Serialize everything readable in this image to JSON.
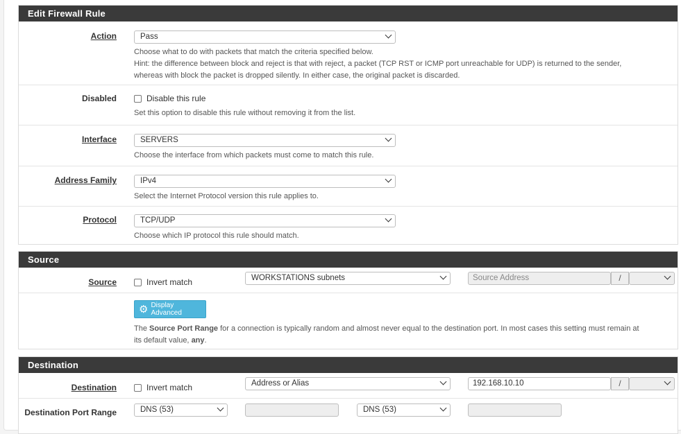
{
  "edit_rule": {
    "title": "Edit Firewall Rule",
    "action": {
      "label": "Action",
      "value": "Pass",
      "help1": "Choose what to do with packets that match the criteria specified below.",
      "help2": "Hint: the difference between block and reject is that with reject, a packet (TCP RST or ICMP port unreachable for UDP) is returned to the sender,",
      "help3": "whereas with block the packet is dropped silently. In either case, the original packet is discarded."
    },
    "disabled": {
      "label": "Disabled",
      "checkbox_label": "Disable this rule",
      "help": "Set this option to disable this rule without removing it from the list."
    },
    "interface": {
      "label": "Interface",
      "value": "SERVERS",
      "help": "Choose the interface from which packets must come to match this rule."
    },
    "address_family": {
      "label": "Address Family",
      "value": "IPv4",
      "help": "Select the Internet Protocol version this rule applies to."
    },
    "protocol": {
      "label": "Protocol",
      "value": "TCP/UDP",
      "help": "Choose which IP protocol this rule should match."
    }
  },
  "source": {
    "title": "Source",
    "label": "Source",
    "invert_label": "Invert match",
    "type_value": "WORKSTATIONS subnets",
    "address_placeholder": "Source Address",
    "slash": "/",
    "advanced_button": "Display Advanced",
    "help_pre": "The ",
    "help_bold": "Source Port Range",
    "help_mid": " for a connection is typically random and almost never equal to the destination port. In most cases this setting must remain at",
    "help_line2_pre": "its default value, ",
    "help_line2_bold": "any",
    "help_line2_end": "."
  },
  "destination": {
    "title": "Destination",
    "label": "Destination",
    "invert_label": "Invert match",
    "type_value": "Address or Alias",
    "address_value": "192.168.10.10",
    "slash": "/",
    "port_range_label": "Destination Port Range",
    "from_port": "DNS (53)",
    "to_port": "DNS (53)"
  }
}
